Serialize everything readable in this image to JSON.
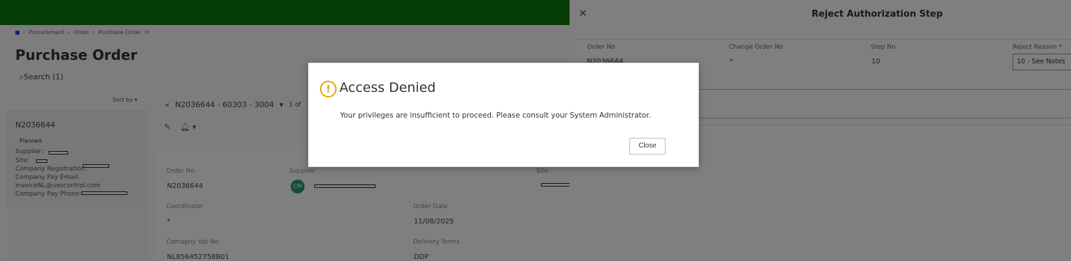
{
  "breadcrumb": {
    "items": [
      "Procurement",
      "Order",
      "Purchase Order"
    ]
  },
  "page": {
    "title": "Purchase Order",
    "search_label": "Search (1)",
    "sort_label": "Sort by",
    "record_nav": "N2036644 - 60303 - 3004",
    "record_count": "1 of"
  },
  "list_card": {
    "order_no": "N2036644",
    "status": "Planned",
    "supplier_label": "Supplier:",
    "site_label": "Site:",
    "company_reg_label": "Company Registration:",
    "pay_email_label": "Company Pay Email:",
    "pay_email_value": "invoiceNL@uxocontrol.com",
    "pay_phone_label": "Company Pay Phone:"
  },
  "detail": {
    "order_no_label": "Order No",
    "order_no_value": "N2036644",
    "supplier_label": "Supplier",
    "supplier_avatar": "CM",
    "site_label": "Site",
    "coordinator_label": "Coordinator",
    "coordinator_value": "*",
    "order_date_label": "Order Date",
    "order_date_value": "11/08/2025",
    "vat_label": "Comapny Vat No",
    "vat_value": "NL856452758B01",
    "delivery_label": "Delivery Terms",
    "delivery_value": "DDP"
  },
  "panel": {
    "title": "Reject Authorization Step",
    "order_no_label": "Order No",
    "order_no_value": "N2036644",
    "change_order_label": "Change Order No",
    "change_order_value": "*",
    "step_no_label": "Step No",
    "step_no_value": "10",
    "reject_reason_label": "Reject Reason",
    "required_mark": "*",
    "reject_reason_value": "10 - See Notes"
  },
  "dialog": {
    "title": "Access Denied",
    "message": "Your privileges are insufficient to proceed. Please consult your System Administrator.",
    "close_label": "Close",
    "icon": "warning-circle-icon"
  },
  "colors": {
    "topbar": "#0d7a0d",
    "warning": "#e0a800",
    "avatar": "#2e9a6e"
  }
}
